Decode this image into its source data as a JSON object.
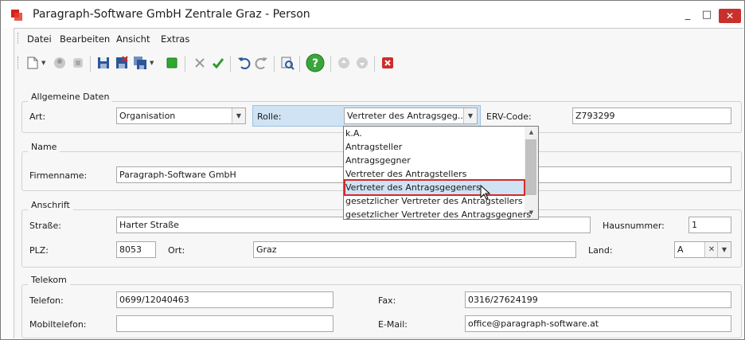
{
  "window": {
    "title": "Paragraph-Software GmbH Zentrale Graz - Person",
    "minimize": "_",
    "maximize": "□",
    "close": "✕"
  },
  "menu": [
    "Datei",
    "Bearbeiten",
    "Ansicht",
    "Extras"
  ],
  "sections": {
    "allgemein": {
      "legend": "Allgemeine Daten",
      "art_label": "Art:",
      "art_value": "Organisation",
      "rolle_label": "Rolle:",
      "rolle_value": "Vertreter des Antragsgeg...",
      "erv_label": "ERV-Code:",
      "erv_value": "Z793299"
    },
    "name": {
      "legend": "Name",
      "firma_label": "Firmenname:",
      "firma_value": "Paragraph-Software GmbH"
    },
    "anschrift": {
      "legend": "Anschrift",
      "strasse_label": "Straße:",
      "strasse_value": "Harter Straße",
      "hausnr_label": "Hausnummer:",
      "hausnr_value": "1",
      "plz_label": "PLZ:",
      "plz_value": "8053",
      "ort_label": "Ort:",
      "ort_value": "Graz",
      "land_label": "Land:",
      "land_value": "A"
    },
    "telekom": {
      "legend": "Telekom",
      "telefon_label": "Telefon:",
      "telefon_value": "0699/12040463",
      "fax_label": "Fax:",
      "fax_value": "0316/27624199",
      "mobil_label": "Mobiltelefon:",
      "mobil_value": "",
      "email_label": "E-Mail:",
      "email_value": "office@paragraph-software.at"
    }
  },
  "rolle_options": [
    "k.A.",
    "Antragsteller",
    "Antragsgegner",
    "Vertreter des Antragstellers",
    "Vertreter des Antragsgegeners",
    "gesetzlicher Vertreter des Antragstellers",
    "gesetzlicher Vertreter des Antragsgegners"
  ],
  "rolle_selected_index": 4,
  "colors": {
    "close": "#c9302c",
    "highlight": "#cfe3f4",
    "selection_border": "#d22b2b"
  }
}
